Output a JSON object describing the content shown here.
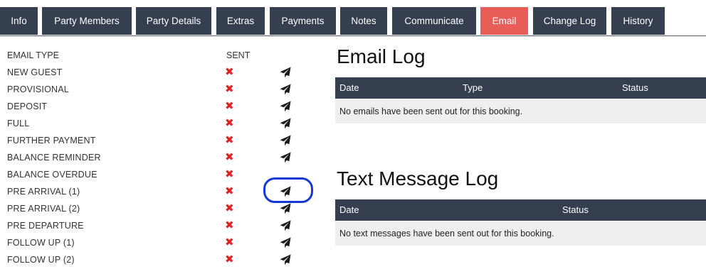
{
  "tabs": [
    {
      "label": "Info"
    },
    {
      "label": "Party Members"
    },
    {
      "label": "Party Details"
    },
    {
      "label": "Extras"
    },
    {
      "label": "Payments"
    },
    {
      "label": "Notes"
    },
    {
      "label": "Communicate"
    },
    {
      "label": "Email",
      "active": true
    },
    {
      "label": "Change Log"
    },
    {
      "label": "History"
    }
  ],
  "email_types": {
    "header_type": "Email Type",
    "header_sent": "Sent",
    "rows": [
      {
        "label": "New Guest",
        "sent": false
      },
      {
        "label": "Provisional",
        "sent": false
      },
      {
        "label": "Deposit",
        "sent": false
      },
      {
        "label": "Full",
        "sent": false
      },
      {
        "label": "Further Payment",
        "sent": false
      },
      {
        "label": "Balance Reminder",
        "sent": false
      },
      {
        "label": "Balance Overdue",
        "sent": false
      },
      {
        "label": "Pre Arrival (1)",
        "sent": false
      },
      {
        "label": "Pre Arrival (2)",
        "sent": false
      },
      {
        "label": "Pre Departure",
        "sent": false
      },
      {
        "label": "Follow Up (1)",
        "sent": false
      },
      {
        "label": "Follow Up (2)",
        "sent": false
      }
    ],
    "not_sent_glyph": "✖",
    "send_icon": "paper-plane-icon"
  },
  "email_log": {
    "title": "Email Log",
    "columns": [
      "Date",
      "Type",
      "Status"
    ],
    "empty_message": "No emails have been sent out for this booking."
  },
  "text_log": {
    "title": "Text Message Log",
    "columns": [
      "Date",
      "Status"
    ],
    "empty_message": "No text messages have been sent out for this booking."
  },
  "colors": {
    "tab_bg": "#353f50",
    "tab_active_bg": "#e85d58",
    "not_sent": "#e02222",
    "highlight": "#1437d6"
  }
}
